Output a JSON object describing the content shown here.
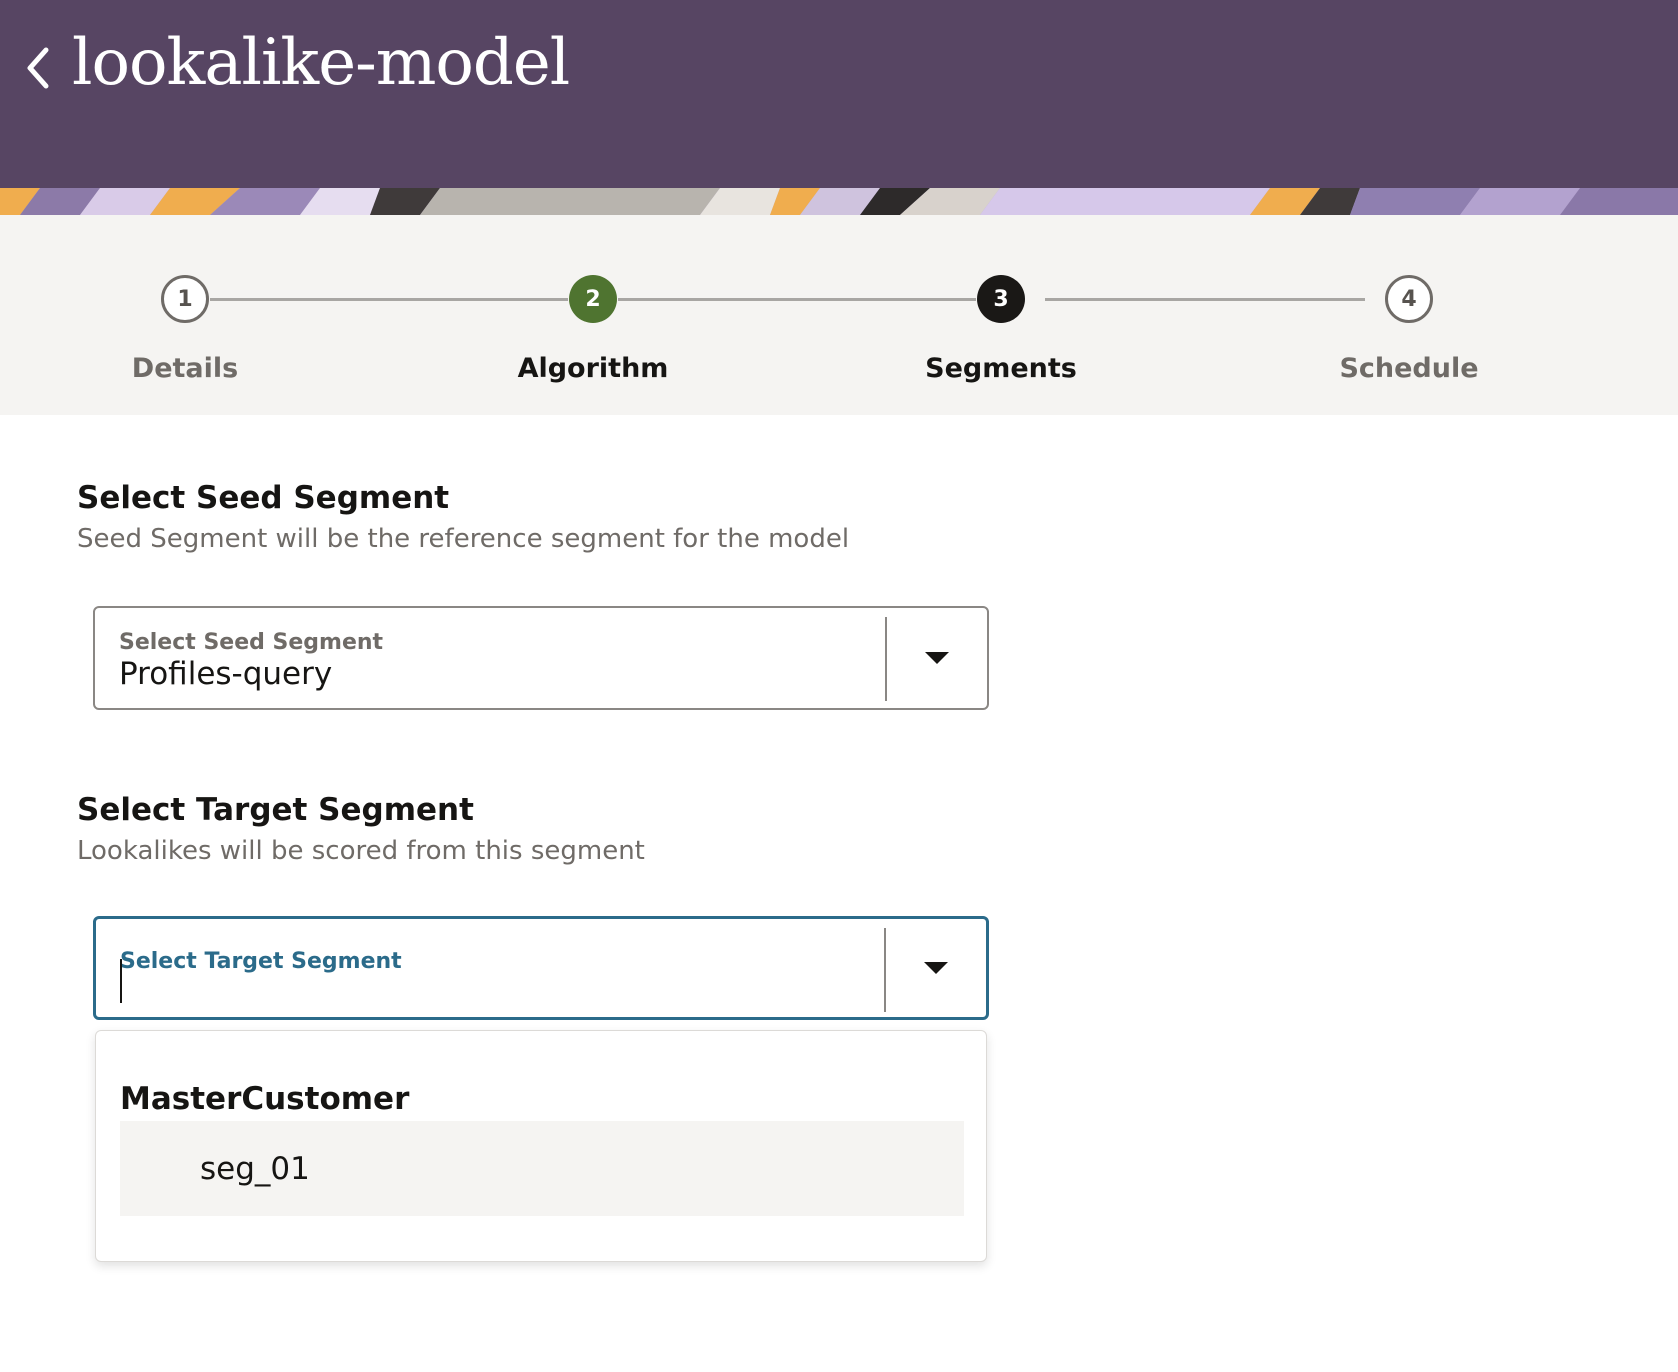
{
  "header": {
    "title": "lookalike-model",
    "back_icon": "chevron-left-icon",
    "background_color": "#574563"
  },
  "train": {
    "steps": [
      {
        "number": "1",
        "label": "Details",
        "state": "pending"
      },
      {
        "number": "2",
        "label": "Algorithm",
        "state": "visited"
      },
      {
        "number": "3",
        "label": "Segments",
        "state": "current"
      },
      {
        "number": "4",
        "label": "Schedule",
        "state": "pending"
      }
    ],
    "visited_color": "#4f7430",
    "current_color": "#1a1816"
  },
  "seed": {
    "title": "Select Seed Segment",
    "description": "Seed Segment will be the reference segment for the model",
    "field_label": "Select Seed Segment",
    "value": "Profiles-query"
  },
  "target": {
    "title": "Select Target Segment",
    "description": "Lookalikes will be scored from this segment",
    "field_label": "Select Target Segment",
    "value": "",
    "focus_color": "#2b6b8a"
  },
  "dropdown": {
    "group": "MasterCustomer",
    "options": [
      "seg_01"
    ]
  }
}
